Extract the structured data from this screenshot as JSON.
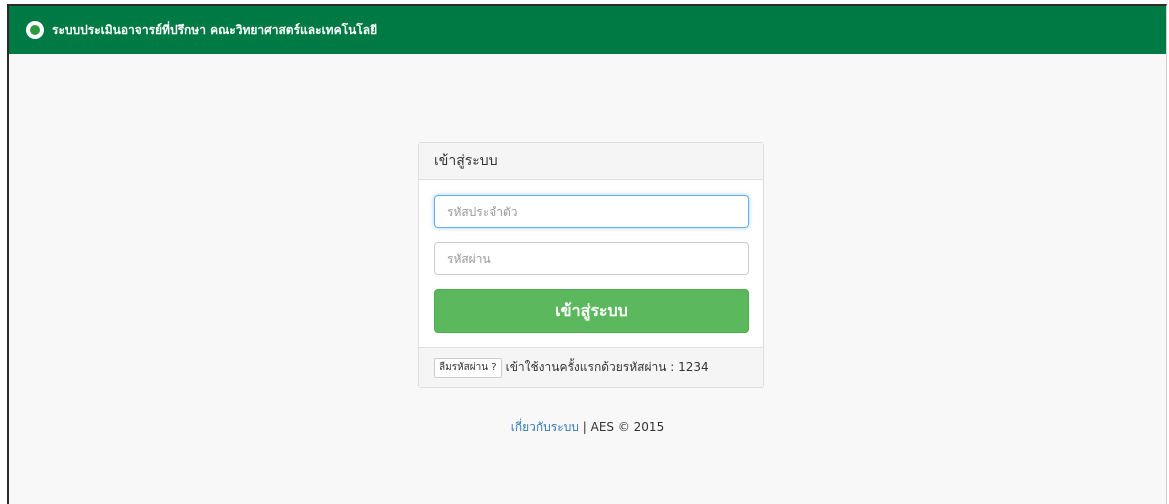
{
  "navbar": {
    "title": "ระบบประเมินอาจารย์ที่ปรึกษา คณะวิทยาศาสตร์และเทคโนโลยี"
  },
  "login": {
    "heading": "เข้าสู่ระบบ",
    "username_placeholder": "รหัสประจำตัว",
    "username_value": "",
    "password_placeholder": "รหัสผ่าน",
    "password_value": "",
    "submit_label": "เข้าสู่ระบบ",
    "forgot_label": "ลืมรหัสผ่าน ?",
    "first_login_note": "เข้าใช้งานครั้งแรกด้วยรหัสผ่าน : 1234"
  },
  "footer": {
    "about_label": "เกี่ยวกับระบบ",
    "copyright": "| AES © 2015"
  },
  "colors": {
    "navbar_background": "#007a45",
    "login_button": "#5cb85c",
    "link": "#337ab7",
    "focus_border": "#66afe9"
  },
  "icons": {
    "brand": "green-circle-logo-icon"
  }
}
